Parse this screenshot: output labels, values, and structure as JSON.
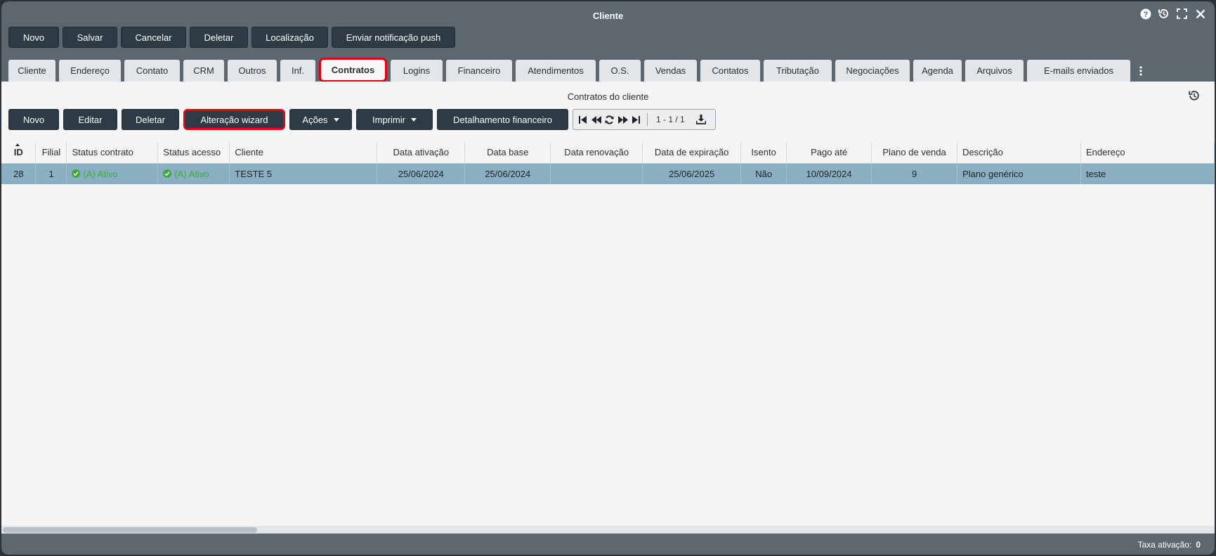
{
  "window": {
    "title": "Cliente"
  },
  "top_toolbar": [
    "Novo",
    "Salvar",
    "Cancelar",
    "Deletar",
    "Localização",
    "Enviar notificação push"
  ],
  "tabs": [
    "Cliente",
    "Endereço",
    "Contato",
    "CRM",
    "Outros",
    "Inf.",
    "Contratos",
    "Logins",
    "Financeiro",
    "Atendimentos",
    "O.S.",
    "Vendas",
    "Contatos",
    "Tributação",
    "Negociações",
    "Agenda",
    "Arquivos",
    "E-mails enviados"
  ],
  "active_tab": "Contratos",
  "panel": {
    "title": "Contratos do cliente",
    "toolbar": {
      "novo": "Novo",
      "editar": "Editar",
      "deletar": "Deletar",
      "wizard": "Alteração wizard",
      "acoes": "Ações",
      "imprimir": "Imprimir",
      "detalhamento": "Detalhamento financeiro"
    },
    "pager": {
      "range": "1 - 1 / 1"
    }
  },
  "table": {
    "columns": [
      "ID",
      "Filial",
      "Status contrato",
      "Status acesso",
      "Cliente",
      "Data ativação",
      "Data base",
      "Data renovação",
      "Data de expiração",
      "Isento",
      "Pago até",
      "Plano de venda",
      "Descrição",
      "Endereço"
    ],
    "rows": [
      {
        "id": "28",
        "filial": "1",
        "status_contrato": "(A) Ativo",
        "status_acesso": "(A) Ativo",
        "cliente": "TESTE 5",
        "data_ativacao": "25/06/2024",
        "data_base": "25/06/2024",
        "data_renovacao": "",
        "data_expiracao": "25/06/2025",
        "isento": "Não",
        "pago_ate": "10/09/2024",
        "plano_venda": "9",
        "descricao": "Plano genérico",
        "endereco": "teste"
      }
    ]
  },
  "statusbar": {
    "label": "Taxa ativação:",
    "value": "0"
  },
  "colors": {
    "window": "#5c6770",
    "button": "#2f3b44",
    "highlight": "#e60012",
    "selected_row": "#8aafc3",
    "status_active": "#3fa83f"
  }
}
